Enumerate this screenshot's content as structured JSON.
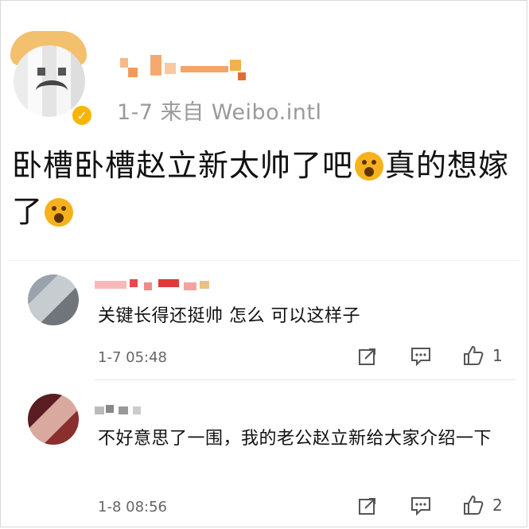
{
  "post": {
    "meta_text": "1-7  来自 Weibo.intl",
    "content_line1": "卧槽卧槽赵立新太帅了吧",
    "content_line1b": "真的想嫁",
    "content_line2": "了"
  },
  "comments": [
    {
      "text": "关键长得还挺帅 怎么 可以这样子",
      "time": "1-7 05:48",
      "like_count": "1"
    },
    {
      "text": "不好意思了一围，我的老公赵立新给大家介绍一下",
      "time": "1-8 08:56",
      "like_count": "2"
    }
  ],
  "icons": {
    "verified": "verified-badge-icon",
    "share": "share-icon",
    "comment": "comment-icon",
    "like": "thumbs-up-icon",
    "emoji": "astonished-hands-emoji"
  },
  "colors": {
    "verified_badge": "#f7b500",
    "meta_gray": "#9a9a9a",
    "emoji_yellow": "#f6b21c"
  }
}
